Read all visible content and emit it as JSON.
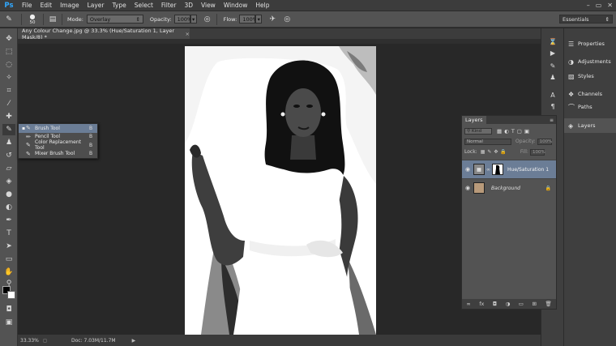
{
  "menubar": {
    "logo": "Ps",
    "items": [
      "File",
      "Edit",
      "Image",
      "Layer",
      "Type",
      "Select",
      "Filter",
      "3D",
      "View",
      "Window",
      "Help"
    ],
    "controls": [
      "–",
      "▭",
      "✕"
    ]
  },
  "options": {
    "brush_size": "50",
    "mode_label": "Mode:",
    "mode_value": "Overlay",
    "opacity_label": "Opacity:",
    "opacity_value": "100%",
    "flow_label": "Flow:",
    "flow_value": "100%",
    "workspace": "Essentials"
  },
  "document": {
    "tab_title": "Any Colour Change.jpg @ 33.3% (Hue/Saturation 1, Layer Mask/8) *",
    "close": "×"
  },
  "flyout": {
    "items": [
      {
        "label": "Brush Tool",
        "key": "B"
      },
      {
        "label": "Pencil Tool",
        "key": "B"
      },
      {
        "label": "Color Replacement Tool",
        "key": "B"
      },
      {
        "label": "Mixer Brush Tool",
        "key": "B"
      }
    ]
  },
  "status": {
    "zoom": "33.33%",
    "doc": "Doc: 7.03M/11.7M"
  },
  "dock": {
    "items": [
      "Properties",
      "Adjustments",
      "Styles",
      "Channels",
      "Paths",
      "Layers"
    ]
  },
  "layers": {
    "tab": "Layers",
    "kind": "Kind",
    "blend_mode": "Normal",
    "opacity_label": "Opacity:",
    "opacity_value": "100%",
    "lock_label": "Lock:",
    "fill_label": "Fill:",
    "fill_value": "100%",
    "list": [
      {
        "name": "Hue/Saturation 1",
        "selected": true
      },
      {
        "name": "Background",
        "selected": false
      }
    ],
    "bottom_icons": [
      "link",
      "fx",
      "mask",
      "adjust",
      "group",
      "new",
      "trash"
    ]
  },
  "colors": {
    "accent": "#6b7d96",
    "ps_blue": "#31a8ff",
    "panel": "#535353",
    "dark": "#282828"
  }
}
